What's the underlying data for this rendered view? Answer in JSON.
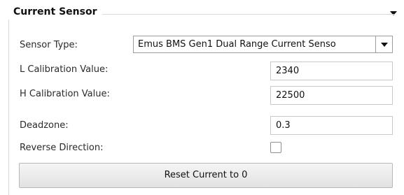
{
  "group": {
    "title": "Current Sensor"
  },
  "fields": {
    "sensor_type_label": "Sensor Type:",
    "sensor_type_value": "Emus BMS Gen1 Dual Range Current Senso",
    "l_calibration_label": "L Calibration Value:",
    "l_calibration_value": "2340",
    "h_calibration_label": "H  Calibration Value:",
    "h_calibration_value": "22500",
    "deadzone_label": "Deadzone:",
    "deadzone_value": "0.3",
    "reverse_direction_label": "Reverse Direction:",
    "reverse_direction_checked": false
  },
  "actions": {
    "reset_label": "Reset Current to 0"
  }
}
